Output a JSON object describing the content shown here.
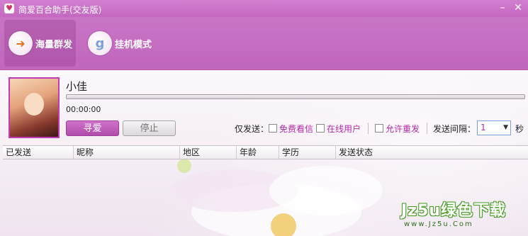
{
  "window": {
    "title": "简爱百合助手(交友版)",
    "icon": "heart-app-icon",
    "controls": [
      "minimize-icon",
      "close-icon"
    ]
  },
  "toolbar": {
    "items": [
      {
        "label": "海量群发",
        "icon": "heart-send-icon",
        "active": true
      },
      {
        "label": "挂机模式",
        "icon": "heart-g-icon",
        "active": false
      }
    ]
  },
  "profile": {
    "nickname": "小佳",
    "elapsed": "00:00:00",
    "progress": 0
  },
  "actions": {
    "find_label": "寻爱",
    "stop_label": "停止"
  },
  "options": {
    "only_send_label": "仅发送：",
    "free_letter_label": "免费看信",
    "online_users_label": "在线用户",
    "allow_resend_label": "允许重发",
    "interval_label": "发送间隔：",
    "interval_value": "1",
    "interval_unit": "秒"
  },
  "table": {
    "columns": [
      "已发送",
      "昵称",
      "地区",
      "年龄",
      "学历",
      "发送状态"
    ],
    "rows": []
  },
  "watermark": {
    "main": "Jz5u绿色下载",
    "sub": "www.Jz5u.Com"
  },
  "colors": {
    "accent": "#c66ac3",
    "accent_text": "#b12ca9",
    "toolbar_bg": "#c470c1"
  }
}
